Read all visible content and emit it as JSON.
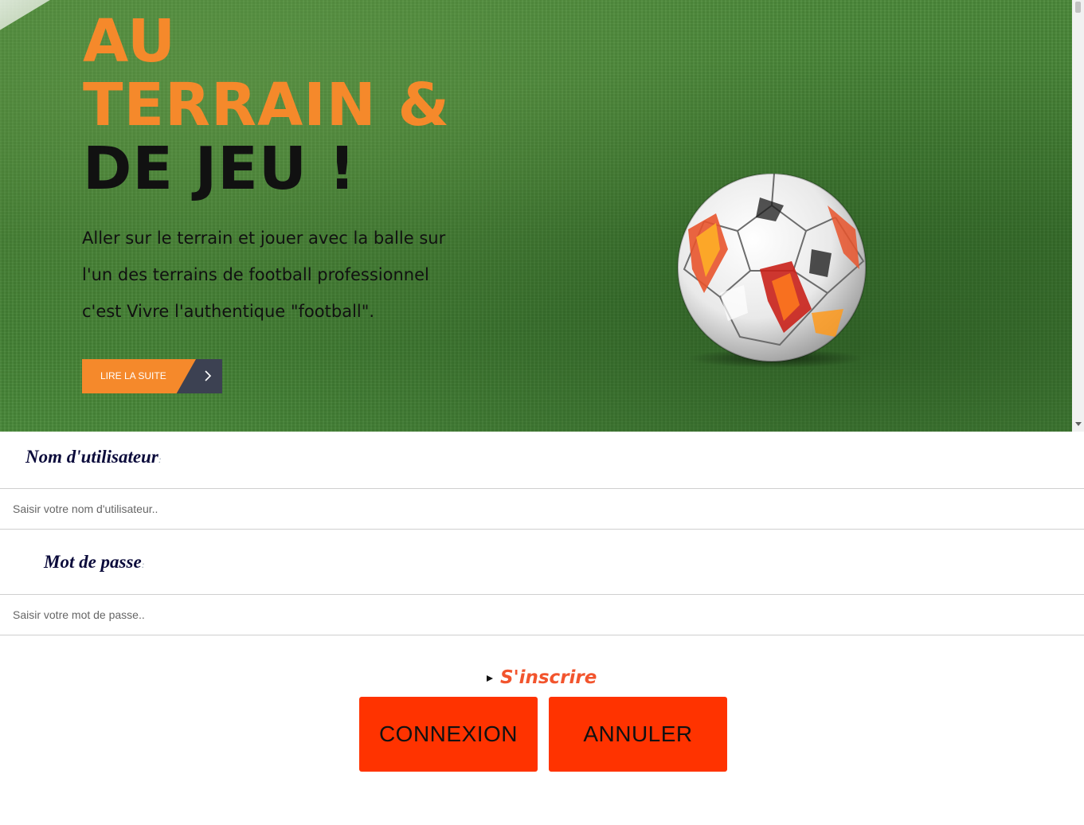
{
  "hero": {
    "title_line1": "AU",
    "title_line2": "TERRAIN &",
    "title_line3": "DE JEU !",
    "description": [
      "Aller sur le terrain et jouer avec la balle sur",
      "l'un des terrains de football professionnel",
      "c'est Vivre l'authentique \"football\"."
    ],
    "read_more_label": "LIRE LA SUITE",
    "read_more_icon": "chevron-right-icon"
  },
  "form": {
    "username_label": "Nom d'utilisateur",
    "username_colon": ":",
    "username_placeholder": "Saisir votre nom d'utilisateur..",
    "username_value": "",
    "password_label": "Mot de passe",
    "password_colon": ":",
    "password_placeholder": "Saisir votre mot de passe..",
    "password_value": "",
    "signup_label": "S'inscrire",
    "login_label": "CONNEXION",
    "cancel_label": "ANNULER"
  },
  "colors": {
    "accent_orange": "#f5892b",
    "button_red": "#ff3300",
    "signup_text": "#f2542d",
    "label_navy": "#0b0b3b",
    "read_more_dark": "#3c4152"
  }
}
